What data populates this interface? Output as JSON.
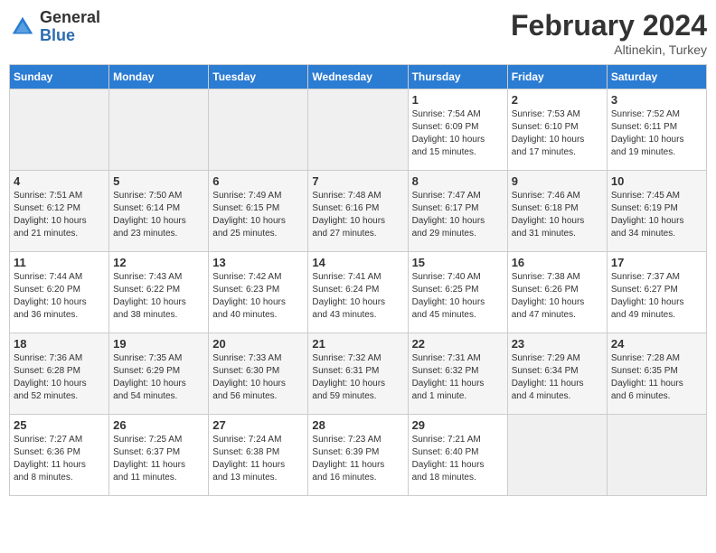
{
  "header": {
    "logo_general": "General",
    "logo_blue": "Blue",
    "title": "February 2024",
    "location": "Altinekin, Turkey"
  },
  "days_of_week": [
    "Sunday",
    "Monday",
    "Tuesday",
    "Wednesday",
    "Thursday",
    "Friday",
    "Saturday"
  ],
  "weeks": [
    [
      {
        "day": "",
        "info": ""
      },
      {
        "day": "",
        "info": ""
      },
      {
        "day": "",
        "info": ""
      },
      {
        "day": "",
        "info": ""
      },
      {
        "day": "1",
        "info": "Sunrise: 7:54 AM\nSunset: 6:09 PM\nDaylight: 10 hours\nand 15 minutes."
      },
      {
        "day": "2",
        "info": "Sunrise: 7:53 AM\nSunset: 6:10 PM\nDaylight: 10 hours\nand 17 minutes."
      },
      {
        "day": "3",
        "info": "Sunrise: 7:52 AM\nSunset: 6:11 PM\nDaylight: 10 hours\nand 19 minutes."
      }
    ],
    [
      {
        "day": "4",
        "info": "Sunrise: 7:51 AM\nSunset: 6:12 PM\nDaylight: 10 hours\nand 21 minutes."
      },
      {
        "day": "5",
        "info": "Sunrise: 7:50 AM\nSunset: 6:14 PM\nDaylight: 10 hours\nand 23 minutes."
      },
      {
        "day": "6",
        "info": "Sunrise: 7:49 AM\nSunset: 6:15 PM\nDaylight: 10 hours\nand 25 minutes."
      },
      {
        "day": "7",
        "info": "Sunrise: 7:48 AM\nSunset: 6:16 PM\nDaylight: 10 hours\nand 27 minutes."
      },
      {
        "day": "8",
        "info": "Sunrise: 7:47 AM\nSunset: 6:17 PM\nDaylight: 10 hours\nand 29 minutes."
      },
      {
        "day": "9",
        "info": "Sunrise: 7:46 AM\nSunset: 6:18 PM\nDaylight: 10 hours\nand 31 minutes."
      },
      {
        "day": "10",
        "info": "Sunrise: 7:45 AM\nSunset: 6:19 PM\nDaylight: 10 hours\nand 34 minutes."
      }
    ],
    [
      {
        "day": "11",
        "info": "Sunrise: 7:44 AM\nSunset: 6:20 PM\nDaylight: 10 hours\nand 36 minutes."
      },
      {
        "day": "12",
        "info": "Sunrise: 7:43 AM\nSunset: 6:22 PM\nDaylight: 10 hours\nand 38 minutes."
      },
      {
        "day": "13",
        "info": "Sunrise: 7:42 AM\nSunset: 6:23 PM\nDaylight: 10 hours\nand 40 minutes."
      },
      {
        "day": "14",
        "info": "Sunrise: 7:41 AM\nSunset: 6:24 PM\nDaylight: 10 hours\nand 43 minutes."
      },
      {
        "day": "15",
        "info": "Sunrise: 7:40 AM\nSunset: 6:25 PM\nDaylight: 10 hours\nand 45 minutes."
      },
      {
        "day": "16",
        "info": "Sunrise: 7:38 AM\nSunset: 6:26 PM\nDaylight: 10 hours\nand 47 minutes."
      },
      {
        "day": "17",
        "info": "Sunrise: 7:37 AM\nSunset: 6:27 PM\nDaylight: 10 hours\nand 49 minutes."
      }
    ],
    [
      {
        "day": "18",
        "info": "Sunrise: 7:36 AM\nSunset: 6:28 PM\nDaylight: 10 hours\nand 52 minutes."
      },
      {
        "day": "19",
        "info": "Sunrise: 7:35 AM\nSunset: 6:29 PM\nDaylight: 10 hours\nand 54 minutes."
      },
      {
        "day": "20",
        "info": "Sunrise: 7:33 AM\nSunset: 6:30 PM\nDaylight: 10 hours\nand 56 minutes."
      },
      {
        "day": "21",
        "info": "Sunrise: 7:32 AM\nSunset: 6:31 PM\nDaylight: 10 hours\nand 59 minutes."
      },
      {
        "day": "22",
        "info": "Sunrise: 7:31 AM\nSunset: 6:32 PM\nDaylight: 11 hours\nand 1 minute."
      },
      {
        "day": "23",
        "info": "Sunrise: 7:29 AM\nSunset: 6:34 PM\nDaylight: 11 hours\nand 4 minutes."
      },
      {
        "day": "24",
        "info": "Sunrise: 7:28 AM\nSunset: 6:35 PM\nDaylight: 11 hours\nand 6 minutes."
      }
    ],
    [
      {
        "day": "25",
        "info": "Sunrise: 7:27 AM\nSunset: 6:36 PM\nDaylight: 11 hours\nand 8 minutes."
      },
      {
        "day": "26",
        "info": "Sunrise: 7:25 AM\nSunset: 6:37 PM\nDaylight: 11 hours\nand 11 minutes."
      },
      {
        "day": "27",
        "info": "Sunrise: 7:24 AM\nSunset: 6:38 PM\nDaylight: 11 hours\nand 13 minutes."
      },
      {
        "day": "28",
        "info": "Sunrise: 7:23 AM\nSunset: 6:39 PM\nDaylight: 11 hours\nand 16 minutes."
      },
      {
        "day": "29",
        "info": "Sunrise: 7:21 AM\nSunset: 6:40 PM\nDaylight: 11 hours\nand 18 minutes."
      },
      {
        "day": "",
        "info": ""
      },
      {
        "day": "",
        "info": ""
      }
    ]
  ]
}
